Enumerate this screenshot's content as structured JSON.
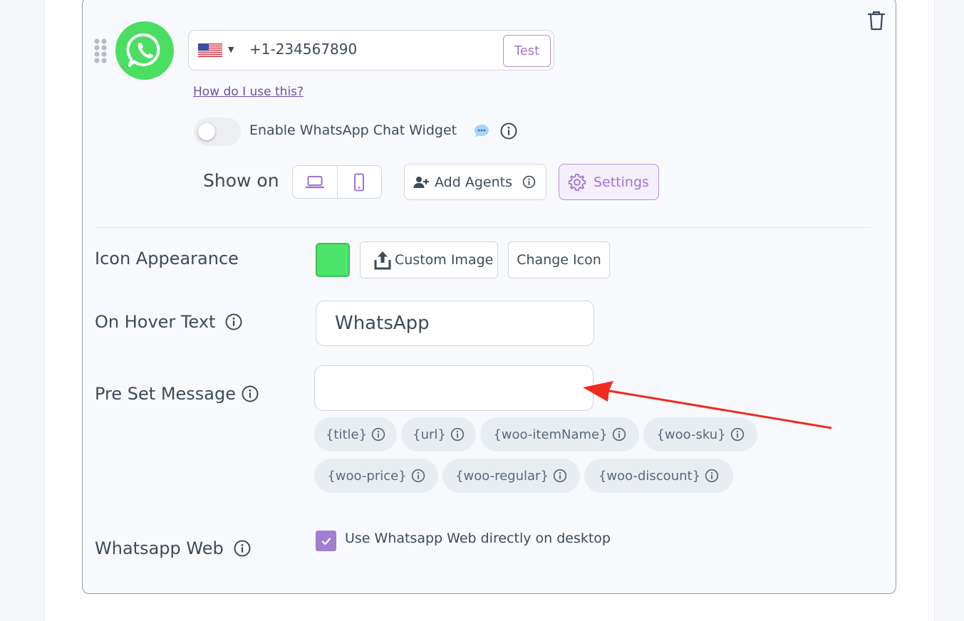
{
  "channel": {
    "icon": "whatsapp-icon",
    "color": "#4ade63",
    "phone": {
      "country_flag": "us-flag",
      "value": "+1-234567890",
      "test_label": "Test"
    },
    "help_link": "How do I use this?",
    "widget": {
      "label": "Enable WhatsApp Chat Widget",
      "enabled": false
    },
    "show_on": {
      "label": "Show on",
      "devices": [
        "desktop-icon",
        "mobile-icon"
      ]
    },
    "add_agents_label": "Add Agents",
    "settings_label": "Settings"
  },
  "settings": {
    "icon_appearance": {
      "label": "Icon Appearance",
      "color": "#4ce46a",
      "custom_image_label": "Custom Image",
      "change_icon_label": "Change Icon"
    },
    "hover_text": {
      "label": "On Hover Text",
      "value": "WhatsApp"
    },
    "preset_message": {
      "label": "Pre Set Message",
      "value": "",
      "tags": [
        "{title}",
        "{url}",
        "{woo-itemName}",
        "{woo-sku}",
        "{woo-price}",
        "{woo-regular}",
        "{woo-discount}"
      ]
    },
    "whatsapp_web": {
      "label": "Whatsapp Web",
      "checkbox_label": "Use Whatsapp Web directly on desktop",
      "checked": true
    }
  },
  "annotation": {
    "type": "arrow",
    "color": "#f02a1d"
  }
}
